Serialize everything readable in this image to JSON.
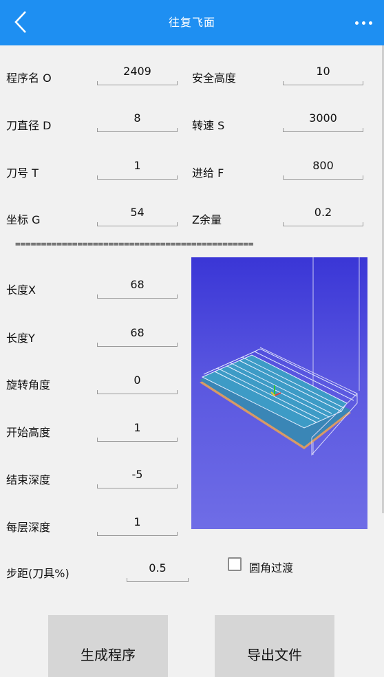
{
  "header": {
    "title": "往复飞面",
    "back_icon": "chevron-left-icon",
    "more_icon": "more-dots-icon"
  },
  "params_top": [
    {
      "label": "程序名 O",
      "value": "2409"
    },
    {
      "label": "安全高度",
      "value": "10"
    },
    {
      "label": "刀直径 D",
      "value": "8"
    },
    {
      "label": "转速 S",
      "value": "3000"
    },
    {
      "label": "刀号 T",
      "value": "1"
    },
    {
      "label": "进给 F",
      "value": "800"
    },
    {
      "label": "坐标 G",
      "value": "54"
    },
    {
      "label": "Z余量",
      "value": "0.2"
    }
  ],
  "divider": "==============================================",
  "params_left": [
    {
      "label": "长度X",
      "value": "68"
    },
    {
      "label": "长度Y",
      "value": "68"
    },
    {
      "label": "旋转角度",
      "value": "0"
    },
    {
      "label": "开始高度",
      "value": "1"
    },
    {
      "label": "结束深度",
      "value": "-5"
    },
    {
      "label": "每层深度",
      "value": "1"
    }
  ],
  "step": {
    "label": "步距(刀具%)",
    "value": "0.5"
  },
  "corner": {
    "label": "圆角过渡"
  },
  "buttons": {
    "generate": "生成程序",
    "export": "导出文件"
  },
  "colors": {
    "header": "#1e8ff2",
    "preview_top": "#3a36d6",
    "preview_bottom": "#6f6de6"
  }
}
